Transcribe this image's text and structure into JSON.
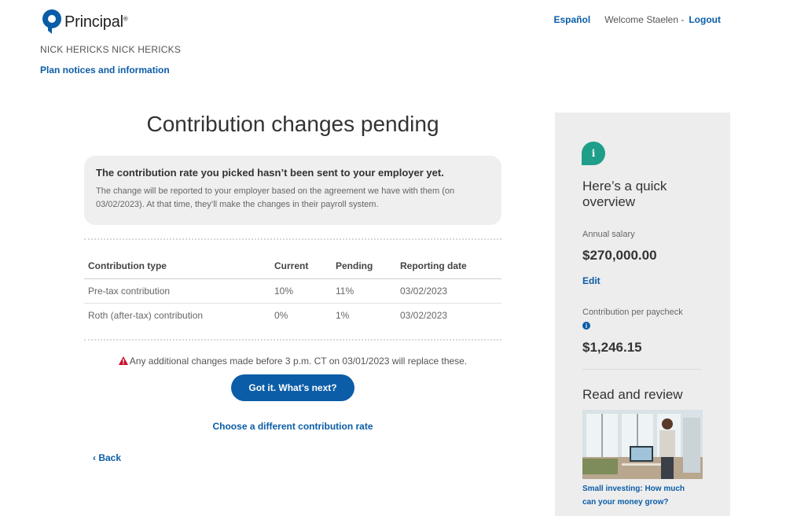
{
  "header": {
    "brand": "Principal",
    "brand_mark": "®",
    "language_link": "Español",
    "welcome_text": "Welcome Staelen -",
    "logout_label": "Logout"
  },
  "account": {
    "member_name": "NICK HERICKS NICK HERICKS",
    "plan_notices_link": "Plan notices and information"
  },
  "main": {
    "title": "Contribution changes pending",
    "notice": {
      "title": "The contribution rate you picked hasn’t been sent to your employer yet.",
      "body": "The change will be reported to your employer based on the agreement we have with them (on 03/02/2023). At that time, they’ll make the changes in their payroll system."
    },
    "table": {
      "headers": [
        "Contribution type",
        "Current",
        "Pending",
        "Reporting date"
      ],
      "rows": [
        [
          "Pre-tax contribution",
          "10%",
          "11%",
          "03/02/2023"
        ],
        [
          "Roth (after-tax) contribution",
          "0%",
          "1%",
          "03/02/2023"
        ]
      ]
    },
    "warning_text": "Any additional changes made before 3 p.m. CT on 03/01/2023 will replace these.",
    "primary_button": "Got it. What’s next?",
    "alt_link": "Choose a different contribution rate",
    "back_label": "Back"
  },
  "sidebar": {
    "info_icon": "i",
    "overview_title": "Here’s a quick overview",
    "salary_label": "Annual salary",
    "salary_value": "$270,000.00",
    "edit_label": "Edit",
    "contribution_label": "Contribution per paycheck",
    "contribution_value": "$1,246.15",
    "review_title": "Read and review",
    "article_link": "Small investing: How much can your money grow?"
  },
  "colors": {
    "brand_blue": "#0b5da7",
    "teal": "#1f9e8a",
    "warning_red": "#c8102e"
  }
}
